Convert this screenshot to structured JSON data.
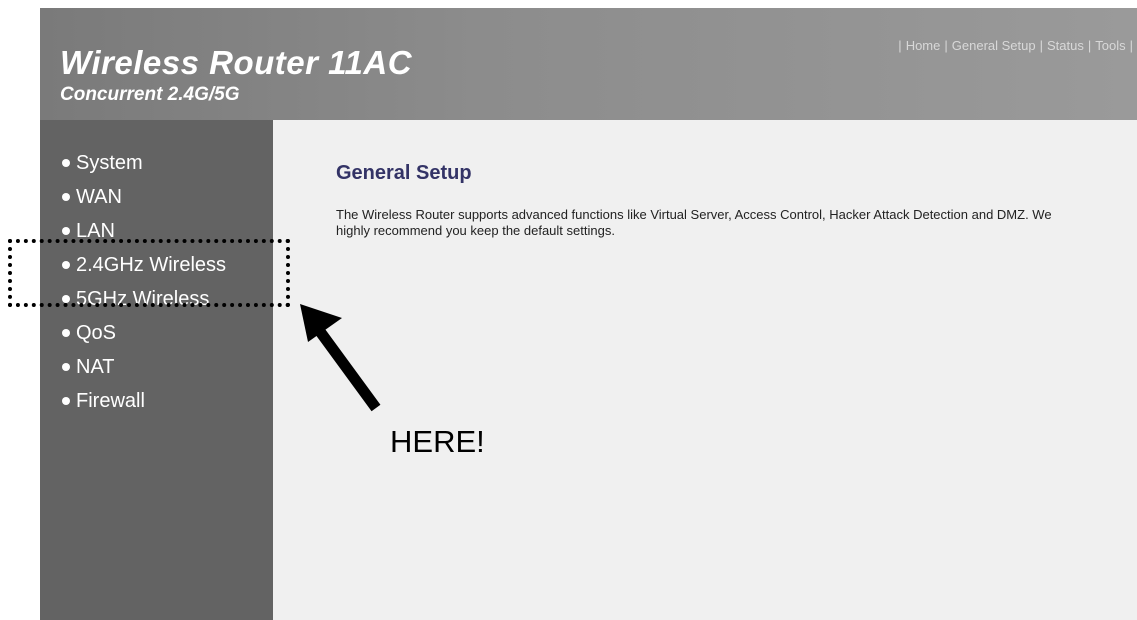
{
  "header": {
    "title": "Wireless Router 11AC",
    "subtitle": "Concurrent 2.4G/5G",
    "nav": [
      "Home",
      "General Setup",
      "Status",
      "Tools"
    ]
  },
  "sidebar": {
    "items": [
      {
        "label": "System"
      },
      {
        "label": "WAN"
      },
      {
        "label": "LAN"
      },
      {
        "label": "2.4GHz Wireless"
      },
      {
        "label": "5GHz Wireless"
      },
      {
        "label": "QoS"
      },
      {
        "label": "NAT"
      },
      {
        "label": "Firewall"
      }
    ]
  },
  "main": {
    "title": "General Setup",
    "description": "The Wireless Router supports advanced functions like Virtual Server, Access Control, Hacker Attack Detection and DMZ. We highly recommend you keep the default settings."
  },
  "annotation": {
    "label": "HERE!"
  },
  "colors": {
    "header_bg": "#8c8c8c",
    "sidebar_bg": "#636363",
    "content_bg": "#f0f0f0",
    "title_color": "#333366"
  },
  "icons": {
    "bullet": "bullet-icon",
    "arrow": "arrow-icon"
  }
}
